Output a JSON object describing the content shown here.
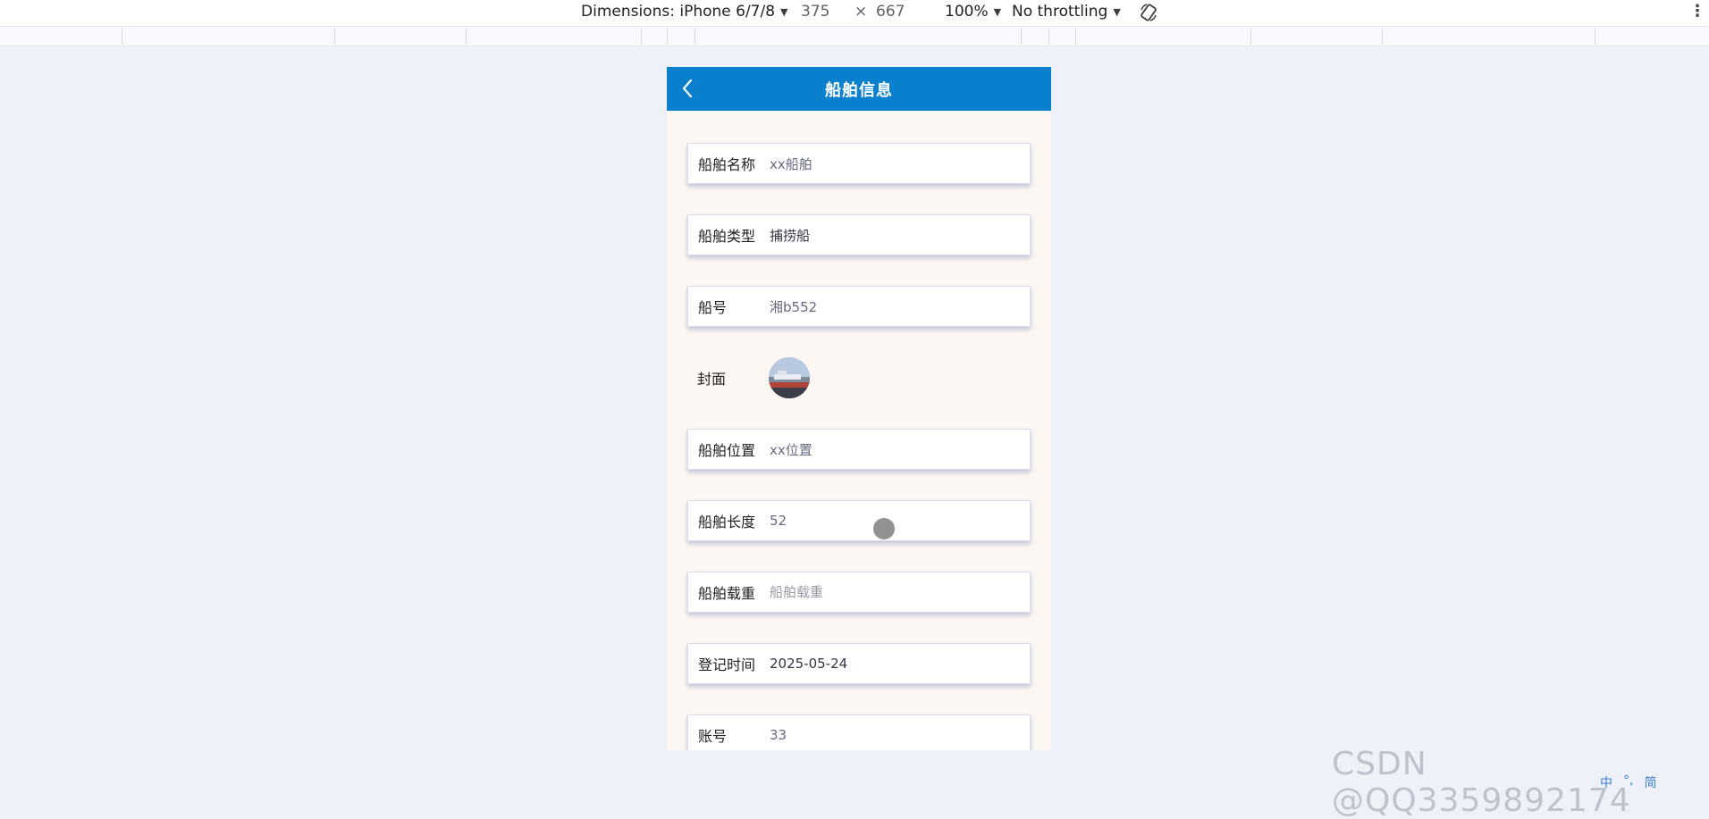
{
  "devtools": {
    "dimensions_label": "Dimensions: iPhone 6/7/8",
    "width": "375",
    "times": "×",
    "height": "667",
    "zoom": "100%",
    "throttling": "No throttling",
    "rotate_icon": "rotate-icon",
    "more_icon": "more-vertical-icon"
  },
  "app": {
    "title": "船舶信息",
    "back_icon": "chevron-left-icon",
    "header_color": "#0a7fce"
  },
  "form": {
    "ship_name": {
      "label": "船舶名称",
      "value": "xx船舶"
    },
    "ship_type": {
      "label": "船舶类型",
      "value": "捕捞船"
    },
    "ship_number": {
      "label": "船号",
      "value": "湘b552"
    },
    "cover": {
      "label": "封面"
    },
    "ship_location": {
      "label": "船舶位置",
      "value": "xx位置"
    },
    "ship_length": {
      "label": "船舶长度",
      "value": "52"
    },
    "ship_load": {
      "label": "船舶载重",
      "placeholder": "船舶载重"
    },
    "register_time": {
      "label": "登记时间",
      "value": "2025-05-24"
    },
    "account": {
      "label": "账号",
      "value": "33"
    }
  },
  "watermark": "CSDN @QQ3359892174",
  "ime": {
    "lang": "中",
    "punct": "°,",
    "mode": "简"
  }
}
